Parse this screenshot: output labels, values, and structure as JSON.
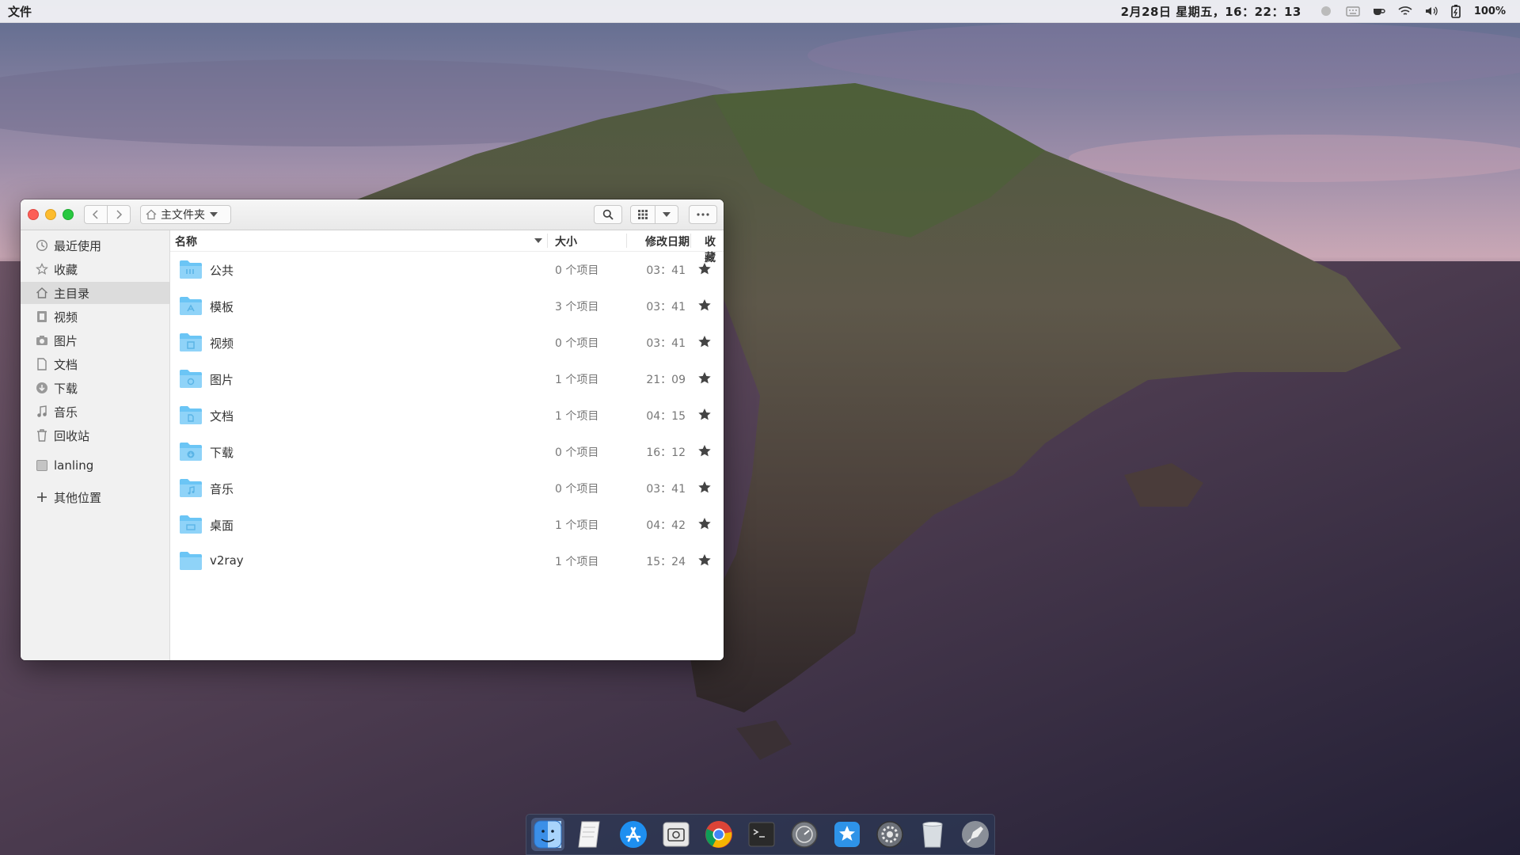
{
  "topbar": {
    "app_menu": "文件",
    "clock": "2月28日 星期五，16：22：13",
    "battery": "100%"
  },
  "window": {
    "location": "主文件夹"
  },
  "sidebar": {
    "items": [
      {
        "label": "最近使用",
        "icon": "clock-icon"
      },
      {
        "label": "收藏",
        "icon": "star-outline-icon"
      },
      {
        "label": "主目录",
        "icon": "home-icon"
      },
      {
        "label": "视频",
        "icon": "film-icon"
      },
      {
        "label": "图片",
        "icon": "camera-icon"
      },
      {
        "label": "文档",
        "icon": "document-icon"
      },
      {
        "label": "下载",
        "icon": "download-icon"
      },
      {
        "label": "音乐",
        "icon": "music-note-icon"
      },
      {
        "label": "回收站",
        "icon": "trash-icon"
      },
      {
        "label": "lanling",
        "icon": "drive-icon"
      },
      {
        "label": "其他位置",
        "icon": "plus-icon"
      }
    ],
    "active": "主目录"
  },
  "columns": {
    "name": "名称",
    "size": "大小",
    "modified": "修改日期",
    "starred": "收藏"
  },
  "files": [
    {
      "name": "公共",
      "size": "0 个项目",
      "modified": "03：41",
      "starred": true,
      "icon": "folder-public-icon"
    },
    {
      "name": "模板",
      "size": "3 个项目",
      "modified": "03：41",
      "starred": true,
      "icon": "folder-templates-icon"
    },
    {
      "name": "视频",
      "size": "0 个项目",
      "modified": "03：41",
      "starred": true,
      "icon": "folder-videos-icon"
    },
    {
      "name": "图片",
      "size": "1 个项目",
      "modified": "21：09",
      "starred": true,
      "icon": "folder-pictures-icon"
    },
    {
      "name": "文档",
      "size": "1 个项目",
      "modified": "04：15",
      "starred": true,
      "icon": "folder-documents-icon"
    },
    {
      "name": "下载",
      "size": "0 个项目",
      "modified": "16：12",
      "starred": true,
      "icon": "folder-downloads-icon"
    },
    {
      "name": "音乐",
      "size": "0 个项目",
      "modified": "03：41",
      "starred": true,
      "icon": "folder-music-icon"
    },
    {
      "name": "桌面",
      "size": "1 个项目",
      "modified": "04：42",
      "starred": true,
      "icon": "folder-desktop-icon"
    },
    {
      "name": "v2ray",
      "size": "1 个项目",
      "modified": "15：24",
      "starred": true,
      "icon": "folder-icon"
    }
  ],
  "dock": {
    "apps": [
      {
        "name": "file-manager-icon",
        "running": true,
        "color": "#3b8fe8"
      },
      {
        "name": "text-editor-icon",
        "running": false,
        "color": "#f4f4f4"
      },
      {
        "name": "app-store-icon",
        "running": false,
        "color": "#1e8ff0"
      },
      {
        "name": "screenshot-icon",
        "running": false,
        "color": "#e8e8e8"
      },
      {
        "name": "chrome-icon",
        "running": false,
        "color": "#db4437"
      },
      {
        "name": "terminal-icon",
        "running": false,
        "color": "#2a2a2a"
      },
      {
        "name": "system-monitor-icon",
        "running": false,
        "color": "#7b7f86"
      },
      {
        "name": "app-center-icon",
        "running": false,
        "color": "#2e93e8"
      },
      {
        "name": "settings-icon",
        "running": false,
        "color": "#6c7078"
      },
      {
        "name": "trash-icon",
        "running": false,
        "color": "#d8dde2"
      },
      {
        "name": "launcher-icon",
        "running": false,
        "color": "#8a8f98"
      }
    ]
  },
  "colors": {
    "folder": "#6bc5f5",
    "traffic_close": "#fc5f57",
    "traffic_min": "#fdbc2e",
    "traffic_max": "#28c840"
  }
}
